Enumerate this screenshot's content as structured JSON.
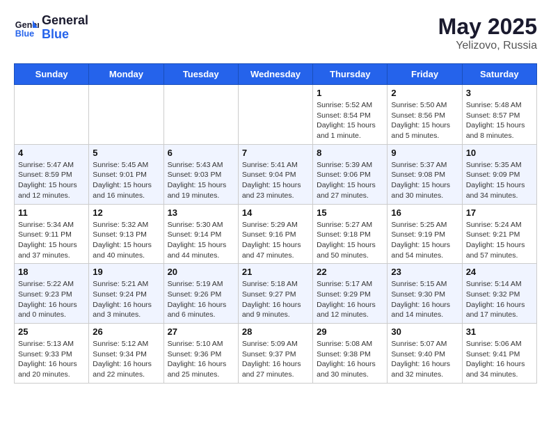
{
  "header": {
    "logo_line1": "General",
    "logo_line2": "Blue",
    "month_year": "May 2025",
    "location": "Yelizovo, Russia"
  },
  "weekdays": [
    "Sunday",
    "Monday",
    "Tuesday",
    "Wednesday",
    "Thursday",
    "Friday",
    "Saturday"
  ],
  "weeks": [
    [
      {
        "day": "",
        "info": ""
      },
      {
        "day": "",
        "info": ""
      },
      {
        "day": "",
        "info": ""
      },
      {
        "day": "",
        "info": ""
      },
      {
        "day": "1",
        "info": "Sunrise: 5:52 AM\nSunset: 8:54 PM\nDaylight: 15 hours\nand 1 minute."
      },
      {
        "day": "2",
        "info": "Sunrise: 5:50 AM\nSunset: 8:56 PM\nDaylight: 15 hours\nand 5 minutes."
      },
      {
        "day": "3",
        "info": "Sunrise: 5:48 AM\nSunset: 8:57 PM\nDaylight: 15 hours\nand 8 minutes."
      }
    ],
    [
      {
        "day": "4",
        "info": "Sunrise: 5:47 AM\nSunset: 8:59 PM\nDaylight: 15 hours\nand 12 minutes."
      },
      {
        "day": "5",
        "info": "Sunrise: 5:45 AM\nSunset: 9:01 PM\nDaylight: 15 hours\nand 16 minutes."
      },
      {
        "day": "6",
        "info": "Sunrise: 5:43 AM\nSunset: 9:03 PM\nDaylight: 15 hours\nand 19 minutes."
      },
      {
        "day": "7",
        "info": "Sunrise: 5:41 AM\nSunset: 9:04 PM\nDaylight: 15 hours\nand 23 minutes."
      },
      {
        "day": "8",
        "info": "Sunrise: 5:39 AM\nSunset: 9:06 PM\nDaylight: 15 hours\nand 27 minutes."
      },
      {
        "day": "9",
        "info": "Sunrise: 5:37 AM\nSunset: 9:08 PM\nDaylight: 15 hours\nand 30 minutes."
      },
      {
        "day": "10",
        "info": "Sunrise: 5:35 AM\nSunset: 9:09 PM\nDaylight: 15 hours\nand 34 minutes."
      }
    ],
    [
      {
        "day": "11",
        "info": "Sunrise: 5:34 AM\nSunset: 9:11 PM\nDaylight: 15 hours\nand 37 minutes."
      },
      {
        "day": "12",
        "info": "Sunrise: 5:32 AM\nSunset: 9:13 PM\nDaylight: 15 hours\nand 40 minutes."
      },
      {
        "day": "13",
        "info": "Sunrise: 5:30 AM\nSunset: 9:14 PM\nDaylight: 15 hours\nand 44 minutes."
      },
      {
        "day": "14",
        "info": "Sunrise: 5:29 AM\nSunset: 9:16 PM\nDaylight: 15 hours\nand 47 minutes."
      },
      {
        "day": "15",
        "info": "Sunrise: 5:27 AM\nSunset: 9:18 PM\nDaylight: 15 hours\nand 50 minutes."
      },
      {
        "day": "16",
        "info": "Sunrise: 5:25 AM\nSunset: 9:19 PM\nDaylight: 15 hours\nand 54 minutes."
      },
      {
        "day": "17",
        "info": "Sunrise: 5:24 AM\nSunset: 9:21 PM\nDaylight: 15 hours\nand 57 minutes."
      }
    ],
    [
      {
        "day": "18",
        "info": "Sunrise: 5:22 AM\nSunset: 9:23 PM\nDaylight: 16 hours\nand 0 minutes."
      },
      {
        "day": "19",
        "info": "Sunrise: 5:21 AM\nSunset: 9:24 PM\nDaylight: 16 hours\nand 3 minutes."
      },
      {
        "day": "20",
        "info": "Sunrise: 5:19 AM\nSunset: 9:26 PM\nDaylight: 16 hours\nand 6 minutes."
      },
      {
        "day": "21",
        "info": "Sunrise: 5:18 AM\nSunset: 9:27 PM\nDaylight: 16 hours\nand 9 minutes."
      },
      {
        "day": "22",
        "info": "Sunrise: 5:17 AM\nSunset: 9:29 PM\nDaylight: 16 hours\nand 12 minutes."
      },
      {
        "day": "23",
        "info": "Sunrise: 5:15 AM\nSunset: 9:30 PM\nDaylight: 16 hours\nand 14 minutes."
      },
      {
        "day": "24",
        "info": "Sunrise: 5:14 AM\nSunset: 9:32 PM\nDaylight: 16 hours\nand 17 minutes."
      }
    ],
    [
      {
        "day": "25",
        "info": "Sunrise: 5:13 AM\nSunset: 9:33 PM\nDaylight: 16 hours\nand 20 minutes."
      },
      {
        "day": "26",
        "info": "Sunrise: 5:12 AM\nSunset: 9:34 PM\nDaylight: 16 hours\nand 22 minutes."
      },
      {
        "day": "27",
        "info": "Sunrise: 5:10 AM\nSunset: 9:36 PM\nDaylight: 16 hours\nand 25 minutes."
      },
      {
        "day": "28",
        "info": "Sunrise: 5:09 AM\nSunset: 9:37 PM\nDaylight: 16 hours\nand 27 minutes."
      },
      {
        "day": "29",
        "info": "Sunrise: 5:08 AM\nSunset: 9:38 PM\nDaylight: 16 hours\nand 30 minutes."
      },
      {
        "day": "30",
        "info": "Sunrise: 5:07 AM\nSunset: 9:40 PM\nDaylight: 16 hours\nand 32 minutes."
      },
      {
        "day": "31",
        "info": "Sunrise: 5:06 AM\nSunset: 9:41 PM\nDaylight: 16 hours\nand 34 minutes."
      }
    ]
  ]
}
